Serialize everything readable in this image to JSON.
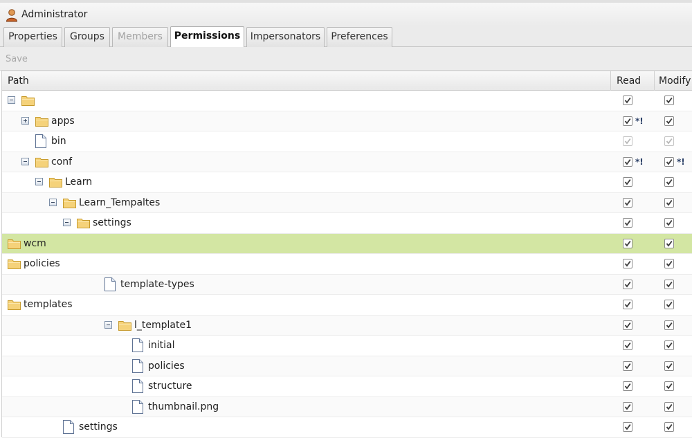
{
  "window": {
    "title": "Administrator"
  },
  "tabs": [
    {
      "label": "Properties",
      "state": "normal"
    },
    {
      "label": "Groups",
      "state": "normal"
    },
    {
      "label": "Members",
      "state": "disabled"
    },
    {
      "label": "Permissions",
      "state": "active"
    },
    {
      "label": "Impersonators",
      "state": "normal"
    },
    {
      "label": "Preferences",
      "state": "normal"
    }
  ],
  "toolbar": {
    "save_label": "Save"
  },
  "columns": {
    "path": "Path",
    "read": "Read",
    "modify": "Modify"
  },
  "marker_text": "*!",
  "colors": {
    "selected_row": "#d3e6a3",
    "folder": "#f5d27a",
    "check": "#3d3d3d"
  },
  "rows": [
    {
      "name": "",
      "type": "folder",
      "expander": "minus",
      "read": true,
      "modify": true,
      "read_marker": false,
      "modify_marker": false,
      "disabled": false,
      "selected": false
    },
    {
      "name": "apps",
      "type": "folder",
      "expander": "plus",
      "read": true,
      "modify": true,
      "read_marker": true,
      "modify_marker": false,
      "disabled": false,
      "selected": false
    },
    {
      "name": "bin",
      "type": "file",
      "expander": "none",
      "read": true,
      "modify": true,
      "read_marker": false,
      "modify_marker": false,
      "disabled": true,
      "selected": false
    },
    {
      "name": "conf",
      "type": "folder",
      "expander": "minus",
      "read": true,
      "modify": true,
      "read_marker": true,
      "modify_marker": true,
      "disabled": false,
      "selected": false
    },
    {
      "name": "Learn",
      "type": "folder",
      "expander": "minus",
      "read": true,
      "modify": true,
      "read_marker": false,
      "modify_marker": false,
      "disabled": false,
      "selected": false
    },
    {
      "name": "Learn_Tempaltes",
      "type": "folder",
      "expander": "minus",
      "read": true,
      "modify": true,
      "read_marker": false,
      "modify_marker": false,
      "disabled": false,
      "selected": false
    },
    {
      "name": "settings",
      "type": "folder",
      "expander": "minus",
      "read": true,
      "modify": true,
      "read_marker": false,
      "modify_marker": false,
      "disabled": false,
      "selected": false
    },
    {
      "name": "wcm",
      "type": "folder",
      "expander": "none",
      "read": true,
      "modify": true,
      "read_marker": false,
      "modify_marker": false,
      "disabled": false,
      "selected": true
    },
    {
      "name": "policies",
      "type": "folder",
      "expander": "none",
      "read": true,
      "modify": true,
      "read_marker": false,
      "modify_marker": false,
      "disabled": false,
      "selected": false
    },
    {
      "name": "template-types",
      "type": "file",
      "expander": "none",
      "read": true,
      "modify": true,
      "read_marker": false,
      "modify_marker": false,
      "disabled": false,
      "selected": false
    },
    {
      "name": "templates",
      "type": "folder",
      "expander": "none",
      "read": true,
      "modify": true,
      "read_marker": false,
      "modify_marker": false,
      "disabled": false,
      "selected": false
    },
    {
      "name": "l_template1",
      "type": "folder",
      "expander": "minus",
      "read": true,
      "modify": true,
      "read_marker": false,
      "modify_marker": false,
      "disabled": false,
      "selected": false
    },
    {
      "name": "initial",
      "type": "file",
      "expander": "none",
      "read": true,
      "modify": true,
      "read_marker": false,
      "modify_marker": false,
      "disabled": false,
      "selected": false
    },
    {
      "name": "policies",
      "type": "file",
      "expander": "none",
      "read": true,
      "modify": true,
      "read_marker": false,
      "modify_marker": false,
      "disabled": false,
      "selected": false
    },
    {
      "name": "structure",
      "type": "file",
      "expander": "none",
      "read": true,
      "modify": true,
      "read_marker": false,
      "modify_marker": false,
      "disabled": false,
      "selected": false
    },
    {
      "name": "thumbnail.png",
      "type": "file",
      "expander": "none",
      "read": true,
      "modify": true,
      "read_marker": false,
      "modify_marker": false,
      "disabled": false,
      "selected": false
    },
    {
      "name": "settings",
      "type": "file",
      "expander": "none",
      "read": true,
      "modify": true,
      "read_marker": false,
      "modify_marker": false,
      "disabled": false,
      "selected": false
    }
  ]
}
